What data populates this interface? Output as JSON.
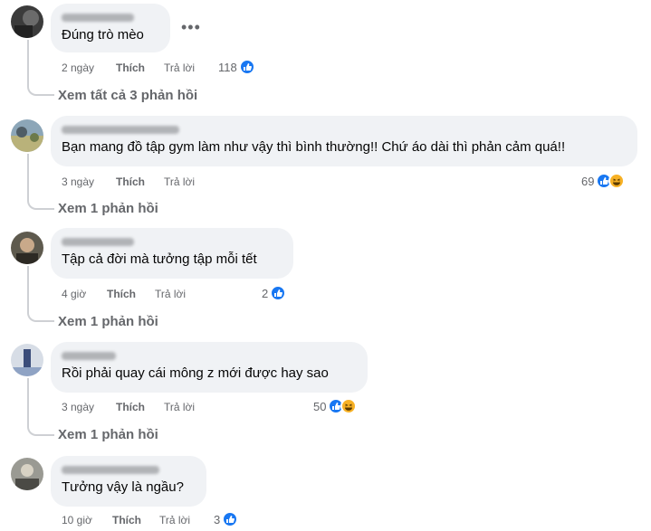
{
  "comments": [
    {
      "text": "Đúng trò mèo",
      "time": "2 ngày",
      "like_label": "Thích",
      "reply_label": "Trả lời",
      "reaction_count": "118",
      "reactions": [
        "like"
      ],
      "view_replies": "Xem tất cả 3 phản hồi"
    },
    {
      "text": "Bạn mang đồ tập gym làm như vậy thì bình thường!! Chứ áo dài thì phản cảm quá!!",
      "time": "3 ngày",
      "like_label": "Thích",
      "reply_label": "Trả lời",
      "reaction_count": "69",
      "reactions": [
        "like",
        "haha"
      ],
      "view_replies": "Xem 1 phản hồi"
    },
    {
      "text": "Tập cả đời mà tưởng tập mỗi tết",
      "time": "4 giờ",
      "like_label": "Thích",
      "reply_label": "Trả lời",
      "reaction_count": "2",
      "reactions": [
        "like"
      ],
      "view_replies": "Xem 1 phản hồi"
    },
    {
      "text": "Rồi phải quay cái mông z mới được hay sao",
      "time": "3 ngày",
      "like_label": "Thích",
      "reply_label": "Trả lời",
      "reaction_count": "50",
      "reactions": [
        "like",
        "haha"
      ],
      "view_replies": "Xem 1 phản hồi"
    },
    {
      "text": "Tưởng vậy là ngầu?",
      "time": "10 giờ",
      "like_label": "Thích",
      "reply_label": "Trả lời",
      "reaction_count": "3",
      "reactions": [
        "like"
      ]
    }
  ],
  "more_options_icon": "more-horizontal-icon",
  "colors": {
    "bubble": "#f0f2f5",
    "meta_text": "#65676b",
    "like_blue": "#1877f2",
    "haha_yellow": "#f7b125"
  }
}
